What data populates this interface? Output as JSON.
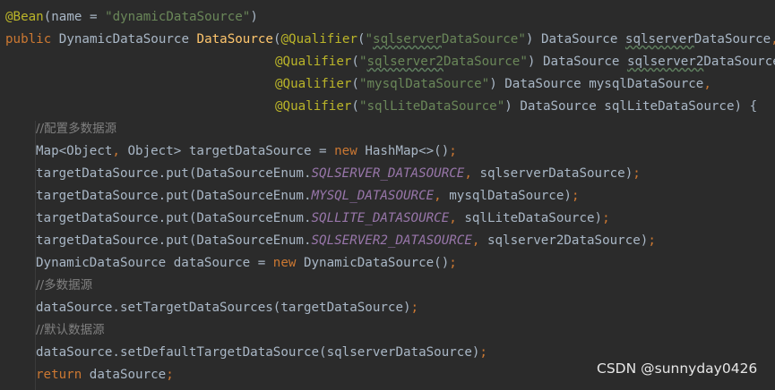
{
  "editor": {
    "theme_colors": {
      "background": "#2b2b2b",
      "default_text": "#a9b7c6",
      "annotation": "#bbb529",
      "keyword": "#cc7832",
      "string": "#6a8759",
      "method_declaration": "#ffc66d",
      "comment": "#808080",
      "static_constant": "#9876aa"
    },
    "lines": [
      {
        "tokens": [
          {
            "t": "@Bean",
            "c": "ann"
          },
          {
            "t": "(name = ",
            "c": "plain"
          },
          {
            "t": "\"dynamicDataSource\"",
            "c": "str"
          },
          {
            "t": ")",
            "c": "plain"
          }
        ]
      },
      {
        "tokens": [
          {
            "t": "public ",
            "c": "kw"
          },
          {
            "t": "DynamicDataSource ",
            "c": "plain"
          },
          {
            "t": "DataSource",
            "c": "fn"
          },
          {
            "t": "(",
            "c": "plain"
          },
          {
            "t": "@Qualifier",
            "c": "ann"
          },
          {
            "t": "(",
            "c": "plain"
          },
          {
            "t": "\"",
            "c": "str"
          },
          {
            "t": "sqlserver",
            "c": "str wavy"
          },
          {
            "t": "DataSource\"",
            "c": "str"
          },
          {
            "t": ") DataSource ",
            "c": "plain"
          },
          {
            "t": "sqlserver",
            "c": "plain wavy"
          },
          {
            "t": "DataSource",
            "c": "plain"
          },
          {
            "t": ",",
            "c": "kw"
          }
        ]
      },
      {
        "tokens": [
          {
            "t": "@Qualifier",
            "c": "ann"
          },
          {
            "t": "(",
            "c": "plain"
          },
          {
            "t": "\"",
            "c": "str"
          },
          {
            "t": "sqlserver2",
            "c": "str wavy"
          },
          {
            "t": "DataSource\"",
            "c": "str"
          },
          {
            "t": ") DataSource ",
            "c": "plain"
          },
          {
            "t": "sqlserver2",
            "c": "plain wavy"
          },
          {
            "t": "DataSource",
            "c": "plain"
          },
          {
            "t": ",",
            "c": "kw"
          }
        ]
      },
      {
        "tokens": [
          {
            "t": "@Qualifier",
            "c": "ann"
          },
          {
            "t": "(",
            "c": "plain"
          },
          {
            "t": "\"mysqlDataSource\"",
            "c": "str"
          },
          {
            "t": ") DataSource mysqlDataSource",
            "c": "plain"
          },
          {
            "t": ",",
            "c": "kw"
          }
        ]
      },
      {
        "tokens": [
          {
            "t": "@Qualifier",
            "c": "ann"
          },
          {
            "t": "(",
            "c": "plain"
          },
          {
            "t": "\"sqlLiteDataSource\"",
            "c": "str"
          },
          {
            "t": ") DataSource sqlLiteDataSource) {",
            "c": "plain"
          }
        ]
      },
      {
        "tokens": [
          {
            "t": "//配置多数据源",
            "c": "cm"
          }
        ]
      },
      {
        "tokens": [
          {
            "t": "Map<Object",
            "c": "plain"
          },
          {
            "t": ", ",
            "c": "kw"
          },
          {
            "t": "Object> targetDataSource = ",
            "c": "plain"
          },
          {
            "t": "new ",
            "c": "kw"
          },
          {
            "t": "HashMap<>()",
            "c": "plain"
          },
          {
            "t": ";",
            "c": "kw"
          }
        ]
      },
      {
        "tokens": [
          {
            "t": "targetDataSource.put(DataSourceEnum.",
            "c": "plain"
          },
          {
            "t": "SQLSERVER_DATASOURCE",
            "c": "cnst"
          },
          {
            "t": ", ",
            "c": "kw"
          },
          {
            "t": "sqlserverDataSource)",
            "c": "plain"
          },
          {
            "t": ";",
            "c": "kw"
          }
        ]
      },
      {
        "tokens": [
          {
            "t": "targetDataSource.put(DataSourceEnum.",
            "c": "plain"
          },
          {
            "t": "MYSQL_DATASOURCE",
            "c": "cnst"
          },
          {
            "t": ", ",
            "c": "kw"
          },
          {
            "t": "mysqlDataSource)",
            "c": "plain"
          },
          {
            "t": ";",
            "c": "kw"
          }
        ]
      },
      {
        "tokens": [
          {
            "t": "targetDataSource.put(DataSourceEnum.",
            "c": "plain"
          },
          {
            "t": "SQLLITE_DATASOURCE",
            "c": "cnst"
          },
          {
            "t": ", ",
            "c": "kw"
          },
          {
            "t": "sqlLiteDataSource)",
            "c": "plain"
          },
          {
            "t": ";",
            "c": "kw"
          }
        ]
      },
      {
        "tokens": [
          {
            "t": "targetDataSource.put(DataSourceEnum.",
            "c": "plain"
          },
          {
            "t": "SQLSERVER2_DATASOURCE",
            "c": "cnst"
          },
          {
            "t": ", ",
            "c": "kw"
          },
          {
            "t": "sqlserver2DataSource)",
            "c": "plain"
          },
          {
            "t": ";",
            "c": "kw"
          }
        ]
      },
      {
        "tokens": [
          {
            "t": "DynamicDataSource dataSource = ",
            "c": "plain"
          },
          {
            "t": "new ",
            "c": "kw"
          },
          {
            "t": "DynamicDataSource()",
            "c": "plain"
          },
          {
            "t": ";",
            "c": "kw"
          }
        ]
      },
      {
        "tokens": [
          {
            "t": "//多数据源",
            "c": "cm"
          }
        ]
      },
      {
        "tokens": [
          {
            "t": "dataSource.setTargetDataSources(targetDataSource)",
            "c": "plain"
          },
          {
            "t": ";",
            "c": "kw"
          }
        ]
      },
      {
        "tokens": [
          {
            "t": "//默认数据源",
            "c": "cm"
          }
        ]
      },
      {
        "tokens": [
          {
            "t": "dataSource.setDefaultTargetDataSource(sqlserverDataSource)",
            "c": "plain"
          },
          {
            "t": ";",
            "c": "kw"
          }
        ]
      },
      {
        "tokens": [
          {
            "t": "return ",
            "c": "kw"
          },
          {
            "t": "dataSource",
            "c": "plain"
          },
          {
            "t": ";",
            "c": "kw"
          }
        ]
      }
    ]
  },
  "watermark": {
    "text": "CSDN @sunnyday0426"
  }
}
